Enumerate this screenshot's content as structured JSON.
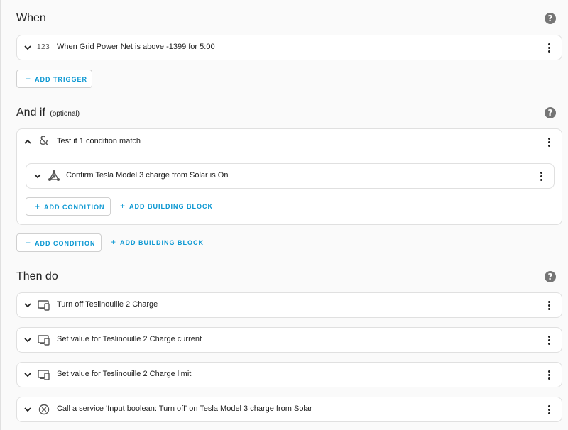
{
  "when": {
    "title": "When",
    "help_icon": "help-circle-icon",
    "triggers": [
      {
        "icon": "numeric-123-icon",
        "icon_text": "123",
        "label": "When Grid Power Net is above -1399 for 5:00"
      }
    ],
    "add_trigger_label": "ADD TRIGGER"
  },
  "and_if": {
    "title": "And if",
    "optional": "(optional)",
    "help_icon": "help-circle-icon",
    "group": {
      "icon": "ampersand-icon",
      "icon_text": "&",
      "label": "Test if 1 condition match",
      "conditions": [
        {
          "icon": "home-assistant-network-icon",
          "label": "Confirm Tesla Model 3 charge from Solar is On"
        }
      ],
      "add_condition_label": "ADD CONDITION",
      "add_building_block_label": "ADD BUILDING BLOCK"
    },
    "add_condition_label": "ADD CONDITION",
    "add_building_block_label": "ADD BUILDING BLOCK"
  },
  "then_do": {
    "title": "Then do",
    "help_icon": "help-circle-icon",
    "actions": [
      {
        "icon": "devices-icon",
        "label": "Turn off Teslinouille 2 Charge"
      },
      {
        "icon": "devices-icon",
        "label": "Set value for Teslinouille 2 Charge current"
      },
      {
        "icon": "devices-icon",
        "label": "Set value for Teslinouille 2 Charge limit"
      },
      {
        "icon": "close-circle-outline-icon",
        "label": "Call a service 'Input boolean: Turn off' on Tesla Model 3 charge from Solar"
      }
    ]
  },
  "colors": {
    "accent": "#0a97d2",
    "help_icon": "#757575",
    "card_border": "#e0e0e0",
    "background": "#fafafa"
  }
}
